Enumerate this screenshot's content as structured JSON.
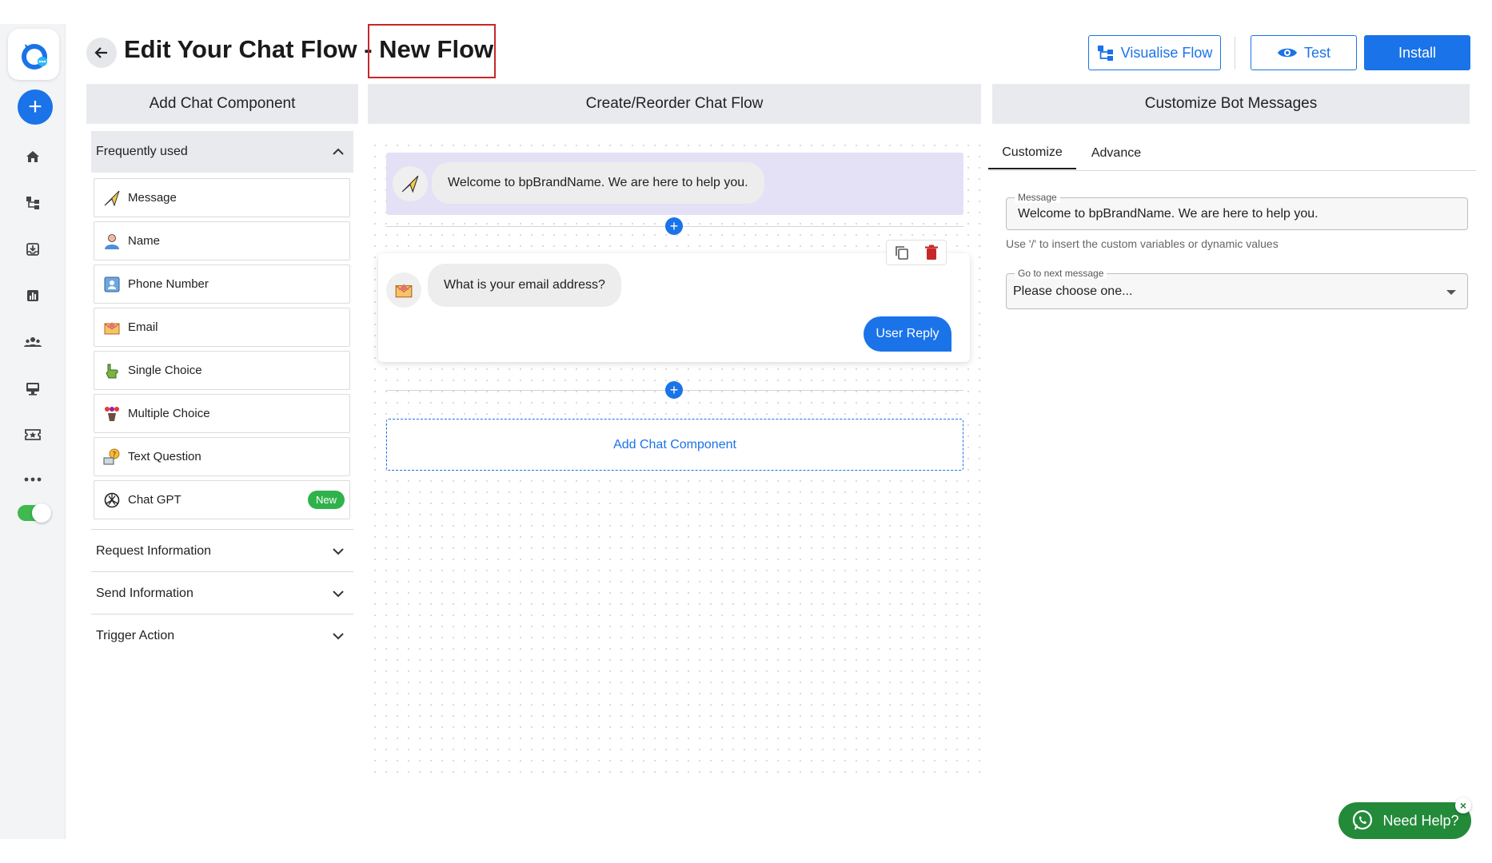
{
  "header": {
    "title": "Edit Your Chat Flow - New Flow",
    "visualise_label": "Visualise Flow",
    "test_label": "Test",
    "install_label": "Install"
  },
  "panels": {
    "left_title": "Add Chat Component",
    "center_title": "Create/Reorder Chat Flow",
    "right_title": "Customize Bot Messages"
  },
  "left": {
    "frequently_used": "Frequently used",
    "items": [
      {
        "label": "Message",
        "icon": "paper-plane-icon"
      },
      {
        "label": "Name",
        "icon": "person-icon"
      },
      {
        "label": "Phone Number",
        "icon": "contact-card-icon"
      },
      {
        "label": "Email",
        "icon": "envelope-icon"
      },
      {
        "label": "Single Choice",
        "icon": "pointing-hand-icon"
      },
      {
        "label": "Multiple Choice",
        "icon": "multiple-choice-icon"
      },
      {
        "label": "Text Question",
        "icon": "question-bubble-icon"
      },
      {
        "label": "Chat GPT",
        "icon": "chatgpt-icon",
        "badge": "New"
      }
    ],
    "sections": [
      "Request Information",
      "Send Information",
      "Trigger Action"
    ]
  },
  "flow": {
    "welcome_message": "Welcome to bpBrandName. We are here to help you.",
    "email_question": "What is your email address?",
    "user_reply_label": "User Reply",
    "add_component_label": "Add Chat Component"
  },
  "right": {
    "tabs": [
      "Customize",
      "Advance"
    ],
    "message_label": "Message",
    "message_value": "Welcome to bpBrandName. We are here to help you.",
    "hint": "Use '/' to insert the custom variables or dynamic values",
    "next_label": "Go to next message",
    "next_value": "Please choose one..."
  },
  "help": {
    "label": "Need Help?"
  },
  "colors": {
    "accent": "#1a73e8",
    "welcome_bg": "#e4e0f6",
    "badge_green": "#2fb24c",
    "help_green": "#238a3a",
    "highlight_red": "#c62828"
  }
}
